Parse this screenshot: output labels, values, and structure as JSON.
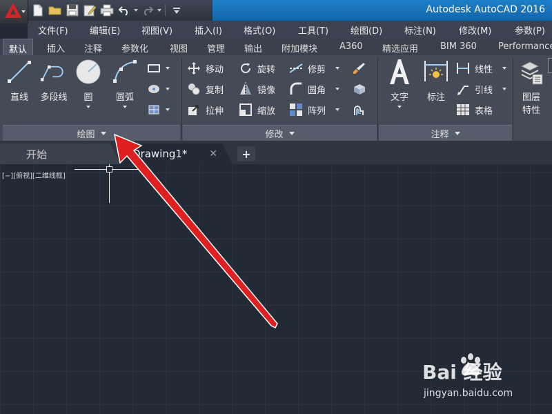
{
  "title": {
    "app_title": "Autodesk AutoCAD 2016"
  },
  "menu": [
    "文件(F)",
    "编辑(E)",
    "视图(V)",
    "插入(I)",
    "格式(O)",
    "工具(T)",
    "绘图(D)",
    "标注(N)",
    "修改(M)",
    "参数(P)"
  ],
  "ribbon_tabs": [
    "默认",
    "插入",
    "注释",
    "参数化",
    "视图",
    "管理",
    "输出",
    "附加模块",
    "A360",
    "精选应用",
    "BIM 360",
    "Performance"
  ],
  "active_tab": "默认",
  "draw_panel": {
    "footer": "绘图",
    "tools": [
      "直线",
      "多段线",
      "圆",
      "圆弧"
    ]
  },
  "modify_panel": {
    "footer": "修改",
    "tools": [
      "移动",
      "旋转",
      "修剪",
      "复制",
      "镜像",
      "圆角",
      "拉伸",
      "缩放",
      "阵列"
    ]
  },
  "annotation_panel": {
    "footer": "注释",
    "tools": [
      "文字",
      "标注",
      "线性",
      "引线",
      "表格"
    ]
  },
  "layers_panel": {
    "tools": [
      "图层",
      "特性"
    ]
  },
  "doc_tabs": {
    "start": "开始",
    "drawing": "Drawing1*"
  },
  "viewport": {
    "label": "[−][俯视][二维线框]"
  },
  "watermark": {
    "main": "Bai 经验",
    "sub": "jingyan.baidu.com"
  },
  "colors": {
    "accent_red": "#e02020",
    "title_blue": "#1e7fc9",
    "canvas_bg": "#222a35"
  }
}
